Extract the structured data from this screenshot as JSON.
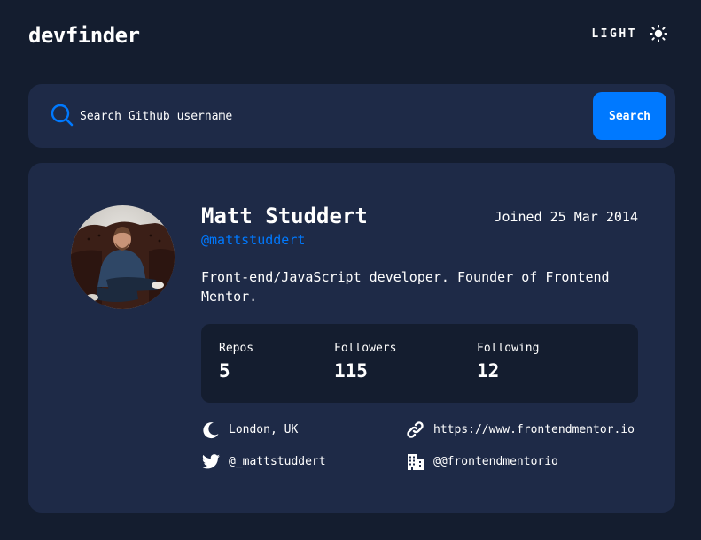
{
  "header": {
    "logo": "devfinder",
    "theme_label": "LIGHT",
    "theme_icon": "sun-icon"
  },
  "search": {
    "placeholder": "Search Github username",
    "value": "",
    "button_label": "Search",
    "icon": "search-icon"
  },
  "profile": {
    "name": "Matt Studdert",
    "login": "@mattstuddert",
    "joined": "Joined 25 Mar 2014",
    "bio": "Front-end/JavaScript developer. Founder of Frontend Mentor.",
    "stats": [
      {
        "label": "Repos",
        "value": "5"
      },
      {
        "label": "Followers",
        "value": "115"
      },
      {
        "label": "Following",
        "value": "12"
      }
    ],
    "links": {
      "location": {
        "text": "London, UK",
        "icon": "location-icon"
      },
      "website": {
        "text": "https://www.frontendmentor.io",
        "icon": "link-icon"
      },
      "twitter": {
        "text": "@_mattstuddert",
        "icon": "twitter-icon"
      },
      "company": {
        "text": "@@frontendmentorio",
        "icon": "company-icon"
      }
    }
  },
  "colors": {
    "background": "#141d2f",
    "card": "#1e2a47",
    "accent": "#0079ff",
    "text": "#ffffff"
  }
}
